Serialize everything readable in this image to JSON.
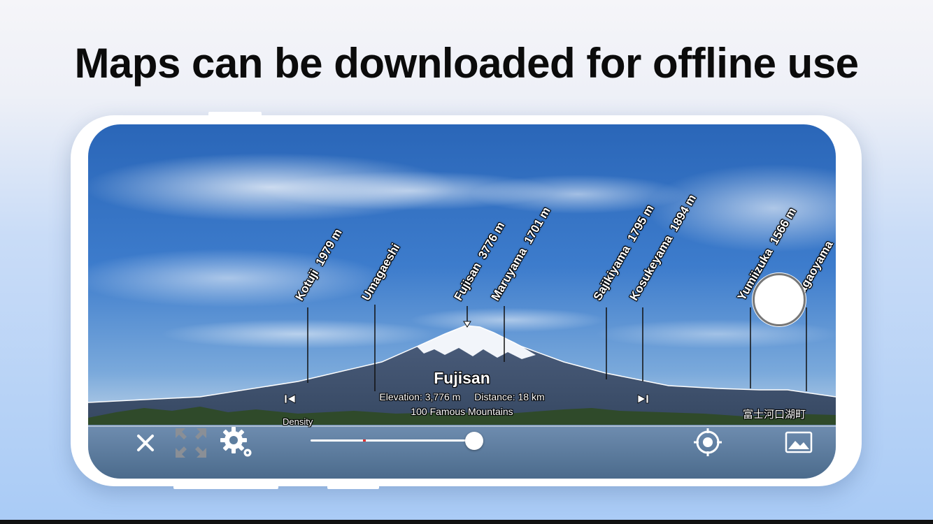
{
  "headline": "Maps can be downloaded for offline use",
  "peaks": [
    {
      "name": "Kotuji",
      "elevation": "1979 m"
    },
    {
      "name": "Umagaeshi",
      "elevation": ""
    },
    {
      "name": "Fujisan",
      "elevation": "3776 m"
    },
    {
      "name": "Maruyama",
      "elevation": "1701 m"
    },
    {
      "name": "Sajikiyama",
      "elevation": "1795 m"
    },
    {
      "name": "Kosukeyama",
      "elevation": "1894 m"
    },
    {
      "name": "Yumiizuka",
      "elevation": "1566 m"
    },
    {
      "name": "Nagaoyama",
      "elevation": ""
    }
  ],
  "selected_peak": {
    "name": "Fujisan",
    "elevation": "Elevation: 3,776 m",
    "distance": "Distance: 18 km",
    "category": "100 Famous Mountains"
  },
  "town_label": "富士河口湖町",
  "density_label": "Density",
  "density_slider": {
    "value_percent": 100
  },
  "icons": {
    "close": "close-icon",
    "fullscreen": "expand-arrows-icon",
    "settings": "gear-icon",
    "locate": "crosshair-location-icon",
    "gallery": "photo-gallery-icon",
    "prev": "skip-previous-icon",
    "next": "skip-next-icon"
  },
  "colors": {
    "sky": "#3d7ccc",
    "lake": "#5d7e9f",
    "accent_red": "#e03030"
  }
}
